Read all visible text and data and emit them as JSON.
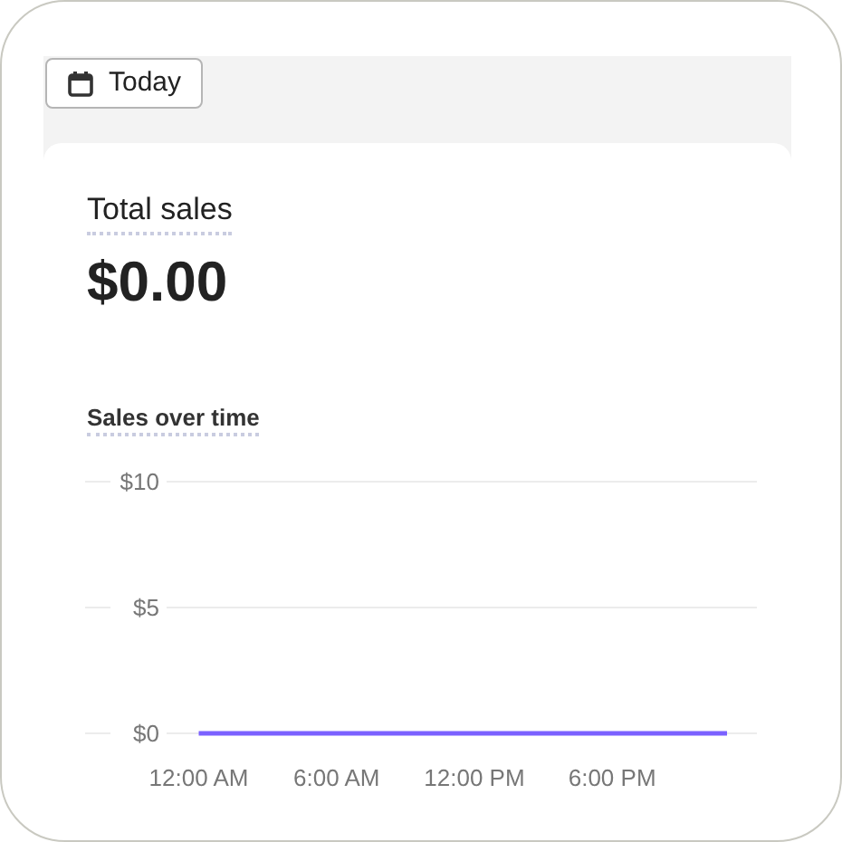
{
  "date_button": {
    "label": "Today"
  },
  "total_sales": {
    "label": "Total sales",
    "value": "$0.00"
  },
  "sales_over_time": {
    "chart_data": {
      "type": "line",
      "title": "Sales over time",
      "x": [
        0,
        23
      ],
      "series": [
        {
          "color": "#7b61ff",
          "values": [
            0,
            0
          ]
        }
      ],
      "xlim": [
        -1.4,
        24.3
      ],
      "ylim": [
        0,
        10
      ],
      "xticks": [
        {
          "value": 0,
          "label": "12:00 AM"
        },
        {
          "value": 6,
          "label": "6:00 AM"
        },
        {
          "value": 12,
          "label": "12:00 PM"
        },
        {
          "value": 18,
          "label": "6:00 PM"
        }
      ],
      "yticks": [
        {
          "value": 0,
          "label": "$0"
        },
        {
          "value": 5,
          "label": "$5"
        },
        {
          "value": 10,
          "label": "$10"
        }
      ]
    }
  }
}
